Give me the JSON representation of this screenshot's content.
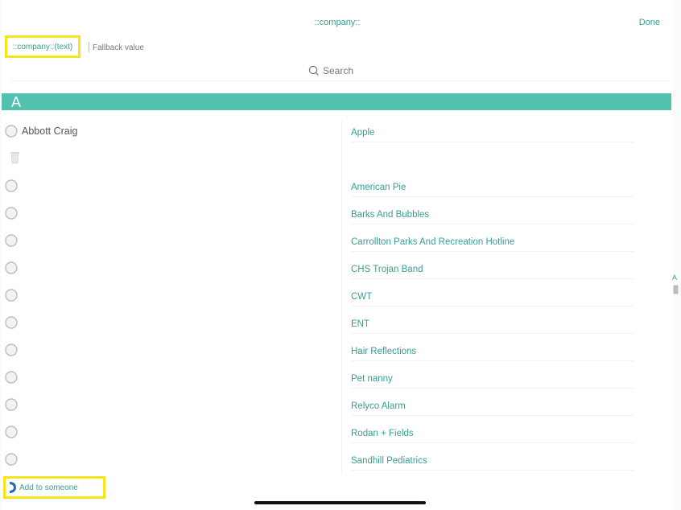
{
  "header": {
    "title": "::company::",
    "done_label": "Done"
  },
  "token": {
    "label": "::company::(text)",
    "fallback_placeholder": "Fallback value"
  },
  "search": {
    "placeholder": "Search"
  },
  "section": {
    "letter": "A"
  },
  "contacts": [
    {
      "name": "Abbott Craig"
    }
  ],
  "companies": [
    "Apple",
    "American Pie",
    "Barks And Bubbles",
    "Carrollton Parks And Recreation Hotline",
    "CHS Trojan Band",
    "CWT",
    "ENT",
    "Hair Reflections",
    "Pet nanny",
    "Relyco Alarm",
    "Rodan + Fields",
    "Sandhill Pediatrics"
  ],
  "index": {
    "letter": "A"
  },
  "footer": {
    "add_label": "Add to someone"
  },
  "colors": {
    "accent": "#3a9e8f",
    "section_bg": "#53c1b0",
    "highlight": "#f5e61c"
  }
}
